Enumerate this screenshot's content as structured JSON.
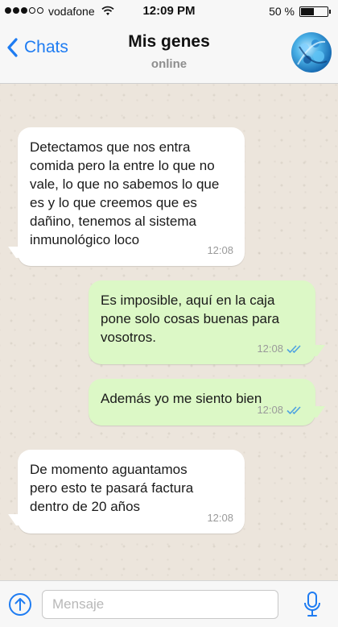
{
  "status_bar": {
    "carrier": "vodafone",
    "time": "12:09 PM",
    "battery_percent": "50 %",
    "battery_level": 0.5,
    "signal_bars_filled": 3,
    "signal_bars_total": 5
  },
  "header": {
    "back_label": "Chats",
    "title": "Mis genes",
    "status": "online",
    "accent_color": "#1e7cf2"
  },
  "messages": [
    {
      "direction": "incoming",
      "text": "Detectamos que nos entra comida pero la entre lo que no vale, lo que no sabemos lo que es y lo que creemos que es dañino, tenemos al sistema inmunológico loco",
      "time": "12:08"
    },
    {
      "direction": "outgoing",
      "text": "Es imposible, aquí en la caja pone solo cosas buenas para vosotros.",
      "time": "12:08",
      "read": true
    },
    {
      "direction": "outgoing",
      "text": "Además yo me siento bien",
      "time": "12:08",
      "read": true
    },
    {
      "direction": "incoming",
      "text": "De momento aguantamos pero esto te pasará factura dentro de 20 años",
      "time": "12:08"
    }
  ],
  "composer": {
    "placeholder": "Mensaje",
    "value": ""
  },
  "colors": {
    "incoming_bubble": "#ffffff",
    "outgoing_bubble": "#dcf8c6",
    "read_check": "#4fa3e0"
  },
  "icons": {
    "back": "chevron-left-icon",
    "upload": "arrow-up-circle-icon",
    "mic": "microphone-icon",
    "wifi": "wifi-icon"
  }
}
